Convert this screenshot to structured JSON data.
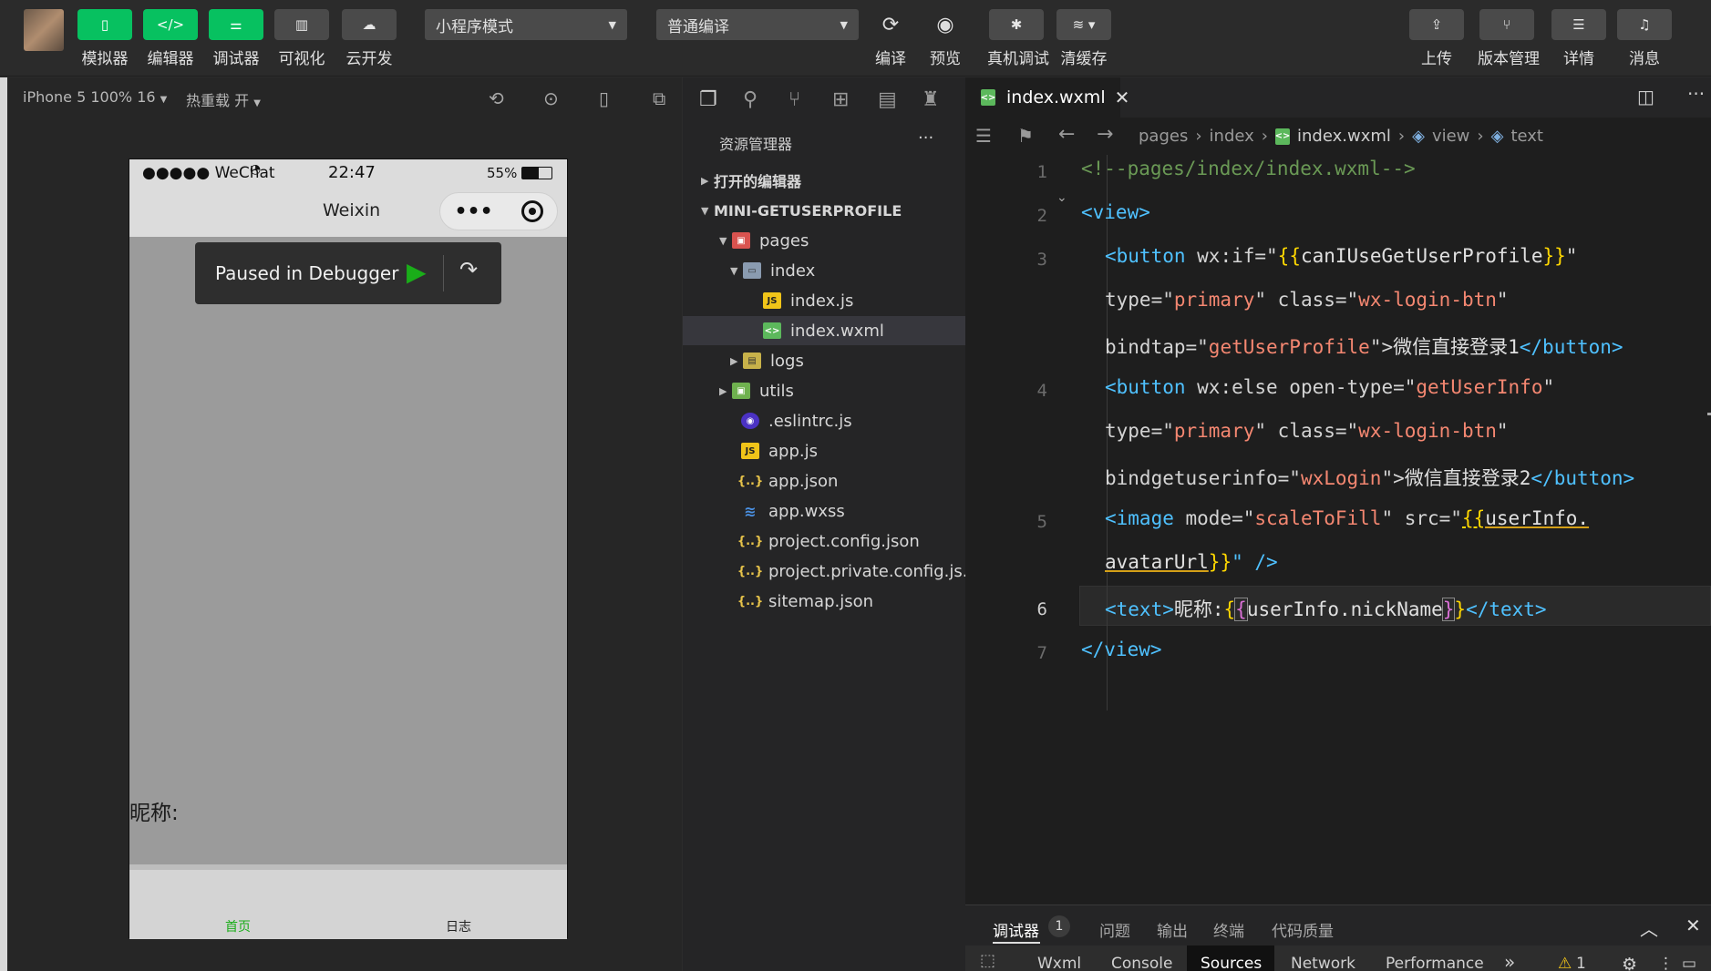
{
  "toolbar": {
    "simulator": "模拟器",
    "editor": "编辑器",
    "debugger": "调试器",
    "visual": "可视化",
    "cloud": "云开发",
    "mode_select": "小程序模式",
    "compile_select": "普通编译",
    "compile": "编译",
    "preview": "预览",
    "real_debug": "真机调试",
    "clear_cache": "清缓存",
    "upload": "上传",
    "version": "版本管理",
    "details": "详情",
    "messages": "消息"
  },
  "simulator": {
    "device": "iPhone 5 100% 16",
    "hot_reload": "热重载 开",
    "status_signal": "●●●●● WeChat",
    "status_time": "22:47",
    "status_battery": "55%",
    "nav_title": "Weixin",
    "capsule_more": "•••",
    "paused_text": "Paused in Debugger",
    "nickname_label": "昵称:",
    "tab_home": "首页",
    "tab_log": "日志"
  },
  "explorer": {
    "title": "资源管理器",
    "more": "···",
    "open_editors": "打开的编辑器",
    "project": "MINI-GETUSERPROFILE",
    "items": [
      {
        "label": "pages"
      },
      {
        "label": "index"
      },
      {
        "label": "index.js"
      },
      {
        "label": "index.wxml"
      },
      {
        "label": "logs"
      },
      {
        "label": "utils"
      },
      {
        "label": ".eslintrc.js"
      },
      {
        "label": "app.js"
      },
      {
        "label": "app.json"
      },
      {
        "label": "app.wxss"
      },
      {
        "label": "project.config.json"
      },
      {
        "label": "project.private.config.js..."
      },
      {
        "label": "sitemap.json"
      }
    ]
  },
  "editor": {
    "tab": "index.wxml",
    "breadcrumb": [
      "pages",
      "index",
      "index.wxml",
      "view",
      "text"
    ],
    "line_numbers": [
      "1",
      "2",
      "3",
      "4",
      "5",
      "6",
      "7"
    ],
    "code": {
      "l1": "<!--pages/index/index.wxml-->",
      "l2_tag": "<view>",
      "l3a_tag": "<button",
      "l3a_attr": " wx:if=\"",
      "l3a_br": "{{",
      "l3a_val": "canIUseGetUserProfile",
      "l3a_br2": "}}",
      "l3a_end": "\"",
      "l3b_attr1": "type=\"",
      "l3b_str1": "primary",
      "l3b_attr2": "\" class=\"",
      "l3b_str2": "wx-login-btn",
      "l3b_end": "\"",
      "l3c_attr": "bindtap=\"",
      "l3c_str": "getUserProfile",
      "l3c_mid": "\">",
      "l3c_txt": "微信直接登录1",
      "l3c_close": "</button>",
      "l4a_tag": "<button",
      "l4a_attr": " wx:else open-type=\"",
      "l4a_str": "getUserInfo",
      "l4a_end": "\"",
      "l4c_attr": "bindgetuserinfo=\"",
      "l4c_str": "wxLogin",
      "l4c_mid": "\">",
      "l4c_txt": "微信直接登录2",
      "l4c_close": "</button>",
      "l5a_tag": "<image",
      "l5a_attr1": " mode=\"",
      "l5a_str": "scaleToFill",
      "l5a_attr2": "\" src=\"",
      "l5a_br": "{{",
      "l5a_val": "userInfo.",
      "l5b_val": "avatarUrl",
      "l5b_br": "}}",
      "l5b_end": "\" />",
      "l6_tag": "<text>",
      "l6_txt": "昵称:",
      "l6_br": "{",
      "l6_br2": "{",
      "l6_val": "userInfo.nickName",
      "l6_br3": "}",
      "l6_br4": "}",
      "l6_close": "</text>",
      "l7_tag": "</view>"
    }
  },
  "debugpanel": {
    "tabs": [
      "调试器",
      "问题",
      "输出",
      "终端",
      "代码质量"
    ],
    "badge": "1",
    "devtools_tabs": [
      "Wxml",
      "Console",
      "Sources",
      "Network",
      "Performance"
    ],
    "more": "»",
    "warning_count": "1"
  }
}
